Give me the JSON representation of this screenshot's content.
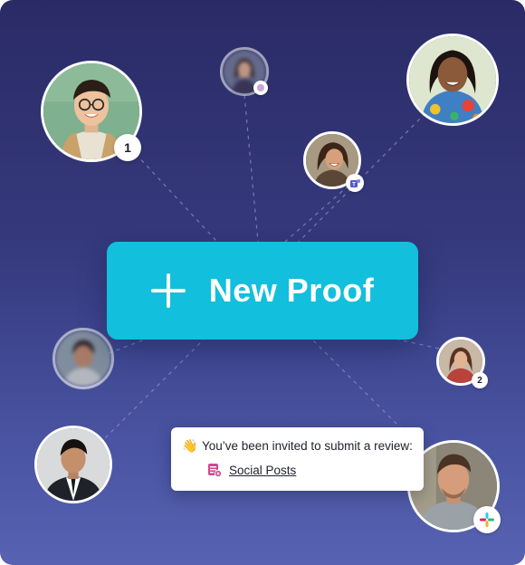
{
  "main_button": {
    "label": "New Proof"
  },
  "invite": {
    "emoji": "👋",
    "message": "You’ve been invited to submit a review:",
    "document_name": "Social Posts"
  },
  "badges": {
    "first": "1",
    "second": "2"
  },
  "integrations": [
    "teams-icon",
    "slack-icon"
  ],
  "colors": {
    "accent": "#12bfdc",
    "background_top": "#2a2b66",
    "background_bottom": "#5763b2",
    "doc_icon": "#d6458f"
  }
}
